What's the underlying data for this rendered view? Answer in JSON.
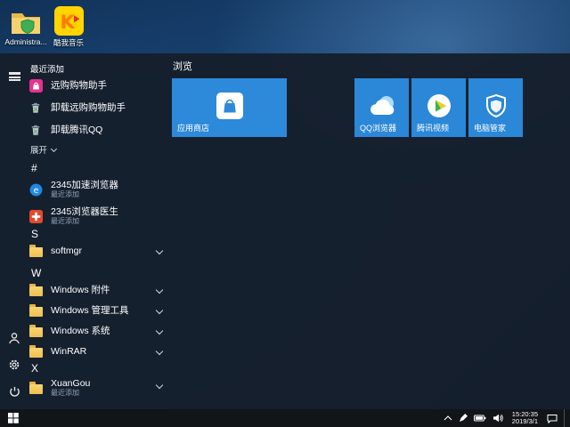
{
  "desktop": {
    "icons": [
      {
        "label": "Administra...",
        "icon": "admin-folder"
      },
      {
        "label": "酷我音乐",
        "icon": "kuwo-music"
      }
    ]
  },
  "start": {
    "recent_header": "最近添加",
    "recent": [
      {
        "label": "远购购物助手",
        "icon": "shopping-assistant"
      },
      {
        "label": "卸载远购购物助手",
        "icon": "uninstall-bin"
      },
      {
        "label": "卸载腾讯QQ",
        "icon": "uninstall-bin"
      }
    ],
    "expand": "展开",
    "groups": [
      {
        "letter": "#",
        "apps": [
          {
            "label": "2345加速浏览器",
            "sub": "最近添加",
            "icon": "browser-e"
          },
          {
            "label": "2345浏览器医生",
            "sub": "最近添加",
            "icon": "doctor-cross"
          }
        ]
      },
      {
        "letter": "S",
        "apps": [
          {
            "label": "softmgr",
            "icon": "folder",
            "expandable": true
          }
        ]
      },
      {
        "letter": "W",
        "apps": [
          {
            "label": "Windows 附件",
            "icon": "folder",
            "expandable": true
          },
          {
            "label": "Windows 管理工具",
            "icon": "folder",
            "expandable": true
          },
          {
            "label": "Windows 系统",
            "icon": "folder",
            "expandable": true
          },
          {
            "label": "WinRAR",
            "icon": "folder",
            "expandable": true
          }
        ]
      },
      {
        "letter": "X",
        "apps": [
          {
            "label": "XuanGou",
            "sub": "最近添加",
            "icon": "folder",
            "expandable": true
          }
        ]
      }
    ],
    "tiles": {
      "group_label": "浏览",
      "store": {
        "label": "应用商店",
        "color": "#2d89da"
      },
      "small": [
        {
          "label": "QQ浏览器",
          "color": "#2b87d8"
        },
        {
          "label": "腾讯视频",
          "color": "#2b87d8"
        },
        {
          "label": "电脑管家",
          "color": "#2b87d8"
        }
      ]
    }
  },
  "taskbar": {
    "time": "15:20:35",
    "date": "2019/3/1"
  }
}
